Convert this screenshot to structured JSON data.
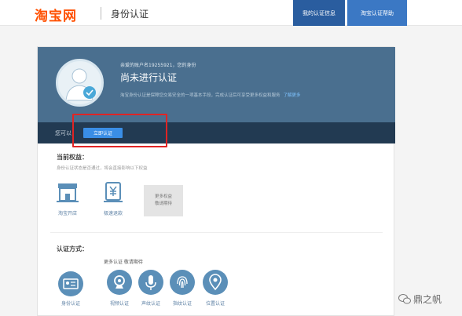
{
  "header": {
    "logo": "淘宝网",
    "page_name": "身份认证",
    "nav": [
      {
        "label": "我的认证信息",
        "active": true
      },
      {
        "label": "淘宝认证帮助",
        "active": false
      }
    ]
  },
  "profile": {
    "greeting": "亲爱的账户名19255921，您的身份",
    "status": "尚未进行认证",
    "description": "淘宝身份认证是保障您交易安全的一项基本手段，完成认证后可享受更多权益和服务",
    "description_link": "了解更多"
  },
  "action_bar": {
    "label": "您可以",
    "verify_button": "立即认证"
  },
  "benefits": {
    "title": "当前权益：",
    "note": "身份认证状态是否通过，将会直接影响以下权益",
    "items": [
      {
        "label": "淘宝开店",
        "icon": "shop-icon"
      },
      {
        "label": "极速退款",
        "icon": "refund-icon"
      }
    ],
    "more": [
      "更多权益",
      "敬请期待"
    ]
  },
  "auth_methods": {
    "title": "认证方式：",
    "more_note": "更多认证 敬请期待",
    "items": [
      {
        "label": "身份认证",
        "icon": "id-card-icon"
      },
      {
        "label": "视频认证",
        "icon": "video-icon"
      },
      {
        "label": "声纹认证",
        "icon": "microphone-icon"
      },
      {
        "label": "指纹认证",
        "icon": "fingerprint-icon"
      },
      {
        "label": "位置认证",
        "icon": "location-icon"
      }
    ]
  },
  "watermark": "鼎之帆",
  "colors": {
    "brand": "#ff5000",
    "hero_bg": "#4a6f8f",
    "action_bar_bg": "#223a52",
    "button": "#3a8ee6",
    "highlight": "#e02424"
  }
}
